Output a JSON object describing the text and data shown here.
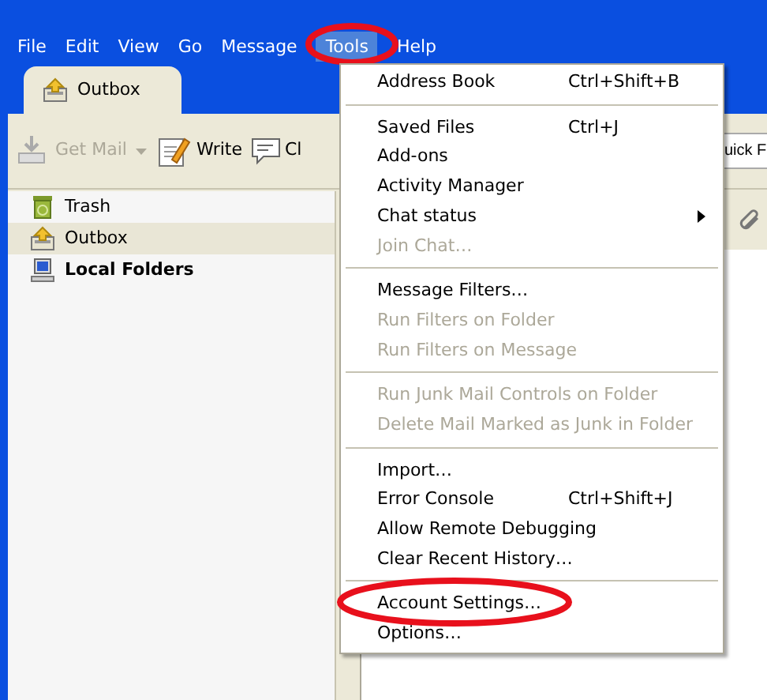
{
  "menubar": [
    {
      "label": "File",
      "selected": false,
      "highlighted": false
    },
    {
      "label": "Edit",
      "selected": false,
      "highlighted": false
    },
    {
      "label": "View",
      "selected": false,
      "highlighted": false
    },
    {
      "label": "Go",
      "selected": false,
      "highlighted": false
    },
    {
      "label": "Message",
      "selected": false,
      "highlighted": false
    },
    {
      "label": "Tools",
      "selected": true,
      "highlighted": true
    },
    {
      "label": "Help",
      "selected": false,
      "highlighted": false
    }
  ],
  "tab": {
    "label": "Outbox"
  },
  "toolbar": [
    {
      "label": "Get Mail",
      "kind": "get-mail",
      "disabled": true
    },
    {
      "label": "Write",
      "kind": "write",
      "disabled": false
    },
    {
      "label": "Cl",
      "kind": "chat",
      "disabled": false
    }
  ],
  "quick_filter": {
    "label": "uick F"
  },
  "folders": [
    {
      "label": "Trash",
      "kind": "trash",
      "selected": false
    },
    {
      "label": "Outbox",
      "kind": "outbox",
      "selected": true
    },
    {
      "label": "Local Folders",
      "kind": "account",
      "selected": false
    }
  ],
  "menu": {
    "groups": [
      [
        {
          "label": "Address Book",
          "shortcut": "Ctrl+Shift+B",
          "disabled": false,
          "submenu": false,
          "highlighted": false
        }
      ],
      [
        {
          "label": "Saved Files",
          "shortcut": "Ctrl+J",
          "disabled": false,
          "submenu": false,
          "highlighted": false
        },
        {
          "label": "Add-ons",
          "disabled": false,
          "submenu": false,
          "highlighted": false
        },
        {
          "label": "Activity Manager",
          "disabled": false,
          "submenu": false,
          "highlighted": false
        },
        {
          "label": "Chat status",
          "disabled": false,
          "submenu": true,
          "highlighted": false
        },
        {
          "label": "Join Chat…",
          "disabled": true,
          "submenu": false,
          "highlighted": false
        }
      ],
      [
        {
          "label": "Message Filters…",
          "disabled": false,
          "submenu": false,
          "highlighted": false
        },
        {
          "label": "Run Filters on Folder",
          "disabled": true,
          "submenu": false,
          "highlighted": false
        },
        {
          "label": "Run Filters on Message",
          "disabled": true,
          "submenu": false,
          "highlighted": false
        }
      ],
      [
        {
          "label": "Run Junk Mail Controls on Folder",
          "disabled": true,
          "submenu": false,
          "highlighted": false
        },
        {
          "label": "Delete Mail Marked as Junk in Folder",
          "disabled": true,
          "submenu": false,
          "highlighted": false
        }
      ],
      [
        {
          "label": "Import…",
          "disabled": false,
          "submenu": false,
          "highlighted": false
        },
        {
          "label": "Error Console",
          "shortcut": "Ctrl+Shift+J",
          "disabled": false,
          "submenu": false,
          "highlighted": false
        },
        {
          "label": "Allow Remote Debugging",
          "disabled": false,
          "submenu": false,
          "highlighted": false
        },
        {
          "label": "Clear Recent History…",
          "disabled": false,
          "submenu": false,
          "highlighted": false
        }
      ],
      [
        {
          "label": "Account Settings…",
          "disabled": false,
          "submenu": false,
          "highlighted": true
        },
        {
          "label": "Options…",
          "disabled": false,
          "submenu": false,
          "highlighted": false
        }
      ]
    ]
  }
}
